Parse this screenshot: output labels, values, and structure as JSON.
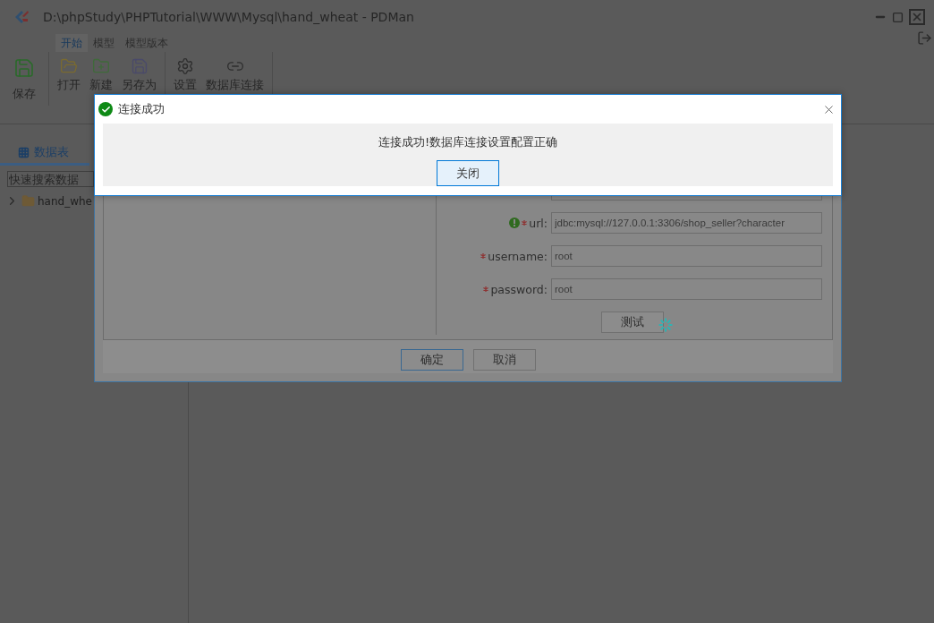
{
  "window": {
    "title": "D:\\phpStudy\\PHPTutorial\\WWW\\Mysql\\hand_wheat - PDMan"
  },
  "ribbon_tabs": [
    {
      "label": "开始",
      "selected": true
    },
    {
      "label": "模型",
      "selected": false
    },
    {
      "label": "模型版本",
      "selected": false
    }
  ],
  "ribbon_groups": [
    [
      {
        "label": "保存",
        "kind": "save-large"
      }
    ],
    [
      {
        "label": "打开",
        "kind": "open"
      },
      {
        "label": "新建",
        "kind": "new"
      },
      {
        "label": "另存为",
        "kind": "save-as"
      }
    ],
    [
      {
        "label": "设置",
        "kind": "settings"
      },
      {
        "label": "数据库连接",
        "kind": "link"
      }
    ]
  ],
  "sidebar": {
    "tab": {
      "label": "数据表",
      "selected": true
    },
    "search": {
      "placeholder": "快速搜索数据"
    },
    "tree": [
      {
        "label": "hand_whe",
        "expanded": false
      }
    ]
  },
  "settings_dialog": {
    "fields": [
      {
        "kind": "blank"
      },
      {
        "kind": "field",
        "label": "url:",
        "required": true,
        "warning": true,
        "value": "jdbc:mysql://127.0.0.1:3306/shop_seller?character"
      },
      {
        "kind": "field",
        "label": "username:",
        "required": true,
        "warning": false,
        "value": "root"
      },
      {
        "kind": "field",
        "label": "password:",
        "required": true,
        "warning": false,
        "value": "root"
      }
    ],
    "test_button": {
      "label": "测试",
      "loading": true
    },
    "buttons": [
      {
        "label": "确定",
        "primary": true
      },
      {
        "label": "取消",
        "primary": false
      }
    ]
  },
  "message_box": {
    "title": "连接成功",
    "kind": "success",
    "message": "连接成功!数据库连接设置配置正确",
    "button": "关闭"
  }
}
